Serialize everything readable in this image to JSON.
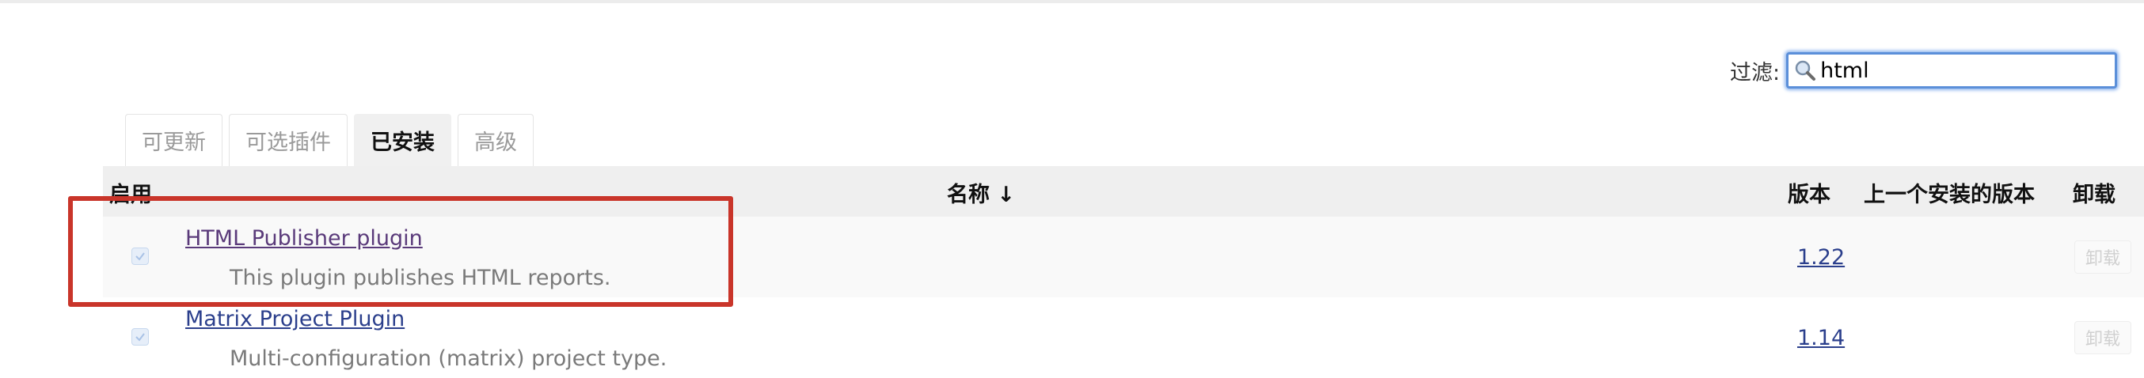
{
  "filter": {
    "label": "过滤:",
    "value": "html",
    "icon": "search-icon"
  },
  "tabs": [
    {
      "label": "可更新",
      "active": false
    },
    {
      "label": "可选插件",
      "active": false
    },
    {
      "label": "已安装",
      "active": true
    },
    {
      "label": "高级",
      "active": false
    }
  ],
  "table": {
    "headers": {
      "enabled": "启用",
      "name": "名称 ↓",
      "version": "版本",
      "previous_version": "上一个安装的版本",
      "uninstall": "卸载"
    },
    "rows": [
      {
        "name": "HTML Publisher plugin",
        "description": "This plugin publishes HTML reports.",
        "version": "1.22",
        "enabled": true,
        "uninstall_label": "卸载"
      },
      {
        "name": "Matrix Project Plugin",
        "description": "Multi-configuration (matrix) project type.",
        "version": "1.14",
        "enabled": true,
        "uninstall_label": "卸载"
      }
    ]
  },
  "colors": {
    "highlight": "#c9352a",
    "link": "#2b3f8c",
    "filter_border": "#5b8fd9"
  }
}
